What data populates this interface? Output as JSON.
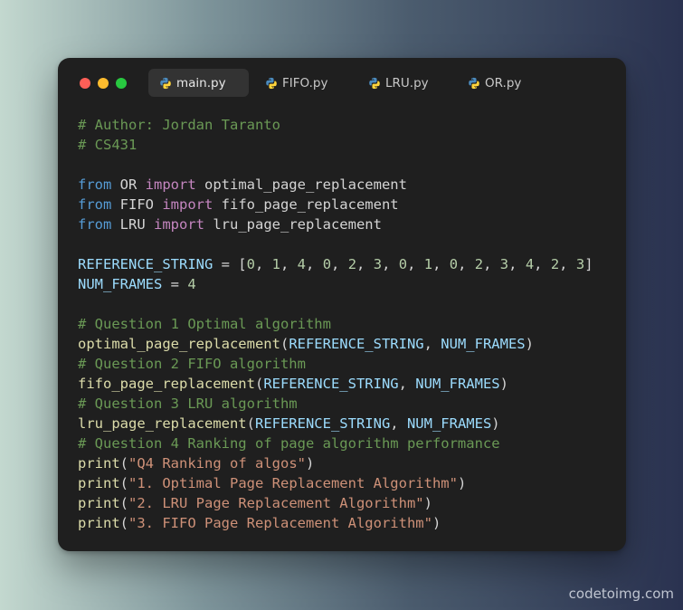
{
  "window": {
    "controls": [
      "close",
      "minimize",
      "maximize"
    ]
  },
  "tabs": [
    {
      "label": "main.py",
      "active": true,
      "icon": "python-icon"
    },
    {
      "label": "FIFO.py",
      "active": false,
      "icon": "python-icon"
    },
    {
      "label": "LRU.py",
      "active": false,
      "icon": "python-icon"
    },
    {
      "label": "OR.py",
      "active": false,
      "icon": "python-icon"
    }
  ],
  "code": {
    "lines": [
      [
        {
          "t": "# Author: Jordan Taranto",
          "c": "com"
        }
      ],
      [
        {
          "t": "# CS431",
          "c": "com"
        }
      ],
      [],
      [
        {
          "t": "from",
          "c": "kw"
        },
        {
          "t": " OR ",
          "c": "id"
        },
        {
          "t": "import",
          "c": "imp"
        },
        {
          "t": " optimal_page_replacement",
          "c": "id"
        }
      ],
      [
        {
          "t": "from",
          "c": "kw"
        },
        {
          "t": " FIFO ",
          "c": "id"
        },
        {
          "t": "import",
          "c": "imp"
        },
        {
          "t": " fifo_page_replacement",
          "c": "id"
        }
      ],
      [
        {
          "t": "from",
          "c": "kw"
        },
        {
          "t": " LRU ",
          "c": "id"
        },
        {
          "t": "import",
          "c": "imp"
        },
        {
          "t": " lru_page_replacement",
          "c": "id"
        }
      ],
      [],
      [
        {
          "t": "REFERENCE_STRING",
          "c": "var"
        },
        {
          "t": " = [",
          "c": "pun"
        },
        {
          "t": "0",
          "c": "num"
        },
        {
          "t": ", ",
          "c": "pun"
        },
        {
          "t": "1",
          "c": "num"
        },
        {
          "t": ", ",
          "c": "pun"
        },
        {
          "t": "4",
          "c": "num"
        },
        {
          "t": ", ",
          "c": "pun"
        },
        {
          "t": "0",
          "c": "num"
        },
        {
          "t": ", ",
          "c": "pun"
        },
        {
          "t": "2",
          "c": "num"
        },
        {
          "t": ", ",
          "c": "pun"
        },
        {
          "t": "3",
          "c": "num"
        },
        {
          "t": ", ",
          "c": "pun"
        },
        {
          "t": "0",
          "c": "num"
        },
        {
          "t": ", ",
          "c": "pun"
        },
        {
          "t": "1",
          "c": "num"
        },
        {
          "t": ", ",
          "c": "pun"
        },
        {
          "t": "0",
          "c": "num"
        },
        {
          "t": ", ",
          "c": "pun"
        },
        {
          "t": "2",
          "c": "num"
        },
        {
          "t": ", ",
          "c": "pun"
        },
        {
          "t": "3",
          "c": "num"
        },
        {
          "t": ", ",
          "c": "pun"
        },
        {
          "t": "4",
          "c": "num"
        },
        {
          "t": ", ",
          "c": "pun"
        },
        {
          "t": "2",
          "c": "num"
        },
        {
          "t": ", ",
          "c": "pun"
        },
        {
          "t": "3",
          "c": "num"
        },
        {
          "t": "]",
          "c": "pun"
        }
      ],
      [
        {
          "t": "NUM_FRAMES",
          "c": "var"
        },
        {
          "t": " = ",
          "c": "pun"
        },
        {
          "t": "4",
          "c": "num"
        }
      ],
      [],
      [
        {
          "t": "# Question 1 Optimal algorithm",
          "c": "com"
        }
      ],
      [
        {
          "t": "optimal_page_replacement",
          "c": "fn"
        },
        {
          "t": "(",
          "c": "pun"
        },
        {
          "t": "REFERENCE_STRING",
          "c": "var"
        },
        {
          "t": ", ",
          "c": "pun"
        },
        {
          "t": "NUM_FRAMES",
          "c": "var"
        },
        {
          "t": ")",
          "c": "pun"
        }
      ],
      [
        {
          "t": "# Question 2 FIFO algorithm",
          "c": "com"
        }
      ],
      [
        {
          "t": "fifo_page_replacement",
          "c": "fn"
        },
        {
          "t": "(",
          "c": "pun"
        },
        {
          "t": "REFERENCE_STRING",
          "c": "var"
        },
        {
          "t": ", ",
          "c": "pun"
        },
        {
          "t": "NUM_FRAMES",
          "c": "var"
        },
        {
          "t": ")",
          "c": "pun"
        }
      ],
      [
        {
          "t": "# Question 3 LRU algorithm",
          "c": "com"
        }
      ],
      [
        {
          "t": "lru_page_replacement",
          "c": "fn"
        },
        {
          "t": "(",
          "c": "pun"
        },
        {
          "t": "REFERENCE_STRING",
          "c": "var"
        },
        {
          "t": ", ",
          "c": "pun"
        },
        {
          "t": "NUM_FRAMES",
          "c": "var"
        },
        {
          "t": ")",
          "c": "pun"
        }
      ],
      [
        {
          "t": "# Question 4 Ranking of page algorithm performance",
          "c": "com"
        }
      ],
      [
        {
          "t": "print",
          "c": "fn"
        },
        {
          "t": "(",
          "c": "pun"
        },
        {
          "t": "\"Q4 Ranking of algos\"",
          "c": "str"
        },
        {
          "t": ")",
          "c": "pun"
        }
      ],
      [
        {
          "t": "print",
          "c": "fn"
        },
        {
          "t": "(",
          "c": "pun"
        },
        {
          "t": "\"1. Optimal Page Replacement Algorithm\"",
          "c": "str"
        },
        {
          "t": ")",
          "c": "pun"
        }
      ],
      [
        {
          "t": "print",
          "c": "fn"
        },
        {
          "t": "(",
          "c": "pun"
        },
        {
          "t": "\"2. LRU Page Replacement Algorithm\"",
          "c": "str"
        },
        {
          "t": ")",
          "c": "pun"
        }
      ],
      [
        {
          "t": "print",
          "c": "fn"
        },
        {
          "t": "(",
          "c": "pun"
        },
        {
          "t": "\"3. FIFO Page Replacement Algorithm\"",
          "c": "str"
        },
        {
          "t": ")",
          "c": "pun"
        }
      ]
    ]
  },
  "watermark": "codetoimg.com",
  "colors": {
    "comment": "#6a9955",
    "keyword": "#569cd6",
    "import": "#c586c0",
    "function": "#dcdcaa",
    "variable": "#9cdcfe",
    "number": "#b5cea8",
    "string": "#ce9178",
    "window_bg": "#1f1f1f"
  }
}
